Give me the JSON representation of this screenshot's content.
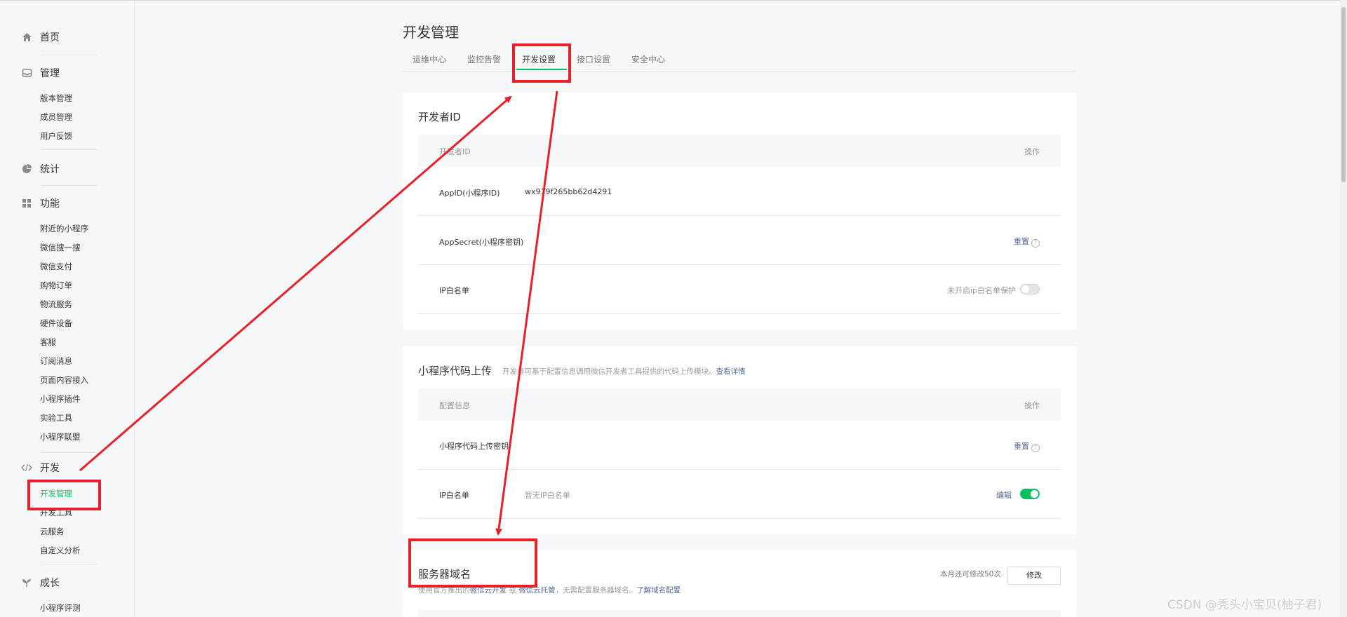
{
  "sidebar": {
    "home": "首页",
    "manage": {
      "title": "管理",
      "items": [
        "版本管理",
        "成员管理",
        "用户反馈"
      ]
    },
    "stats": "统计",
    "features": {
      "title": "功能",
      "items": [
        "附近的小程序",
        "微信搜一搜",
        "微信支付",
        "购物订单",
        "物流服务",
        "硬件设备",
        "客服",
        "订阅消息",
        "页面内容接入",
        "小程序插件",
        "实验工具",
        "小程序联盟"
      ]
    },
    "dev": {
      "title": "开发",
      "items": [
        "开发管理",
        "开发工具",
        "云服务",
        "自定义分析"
      ]
    },
    "growth": {
      "title": "成长",
      "items": [
        "小程序评测"
      ]
    }
  },
  "main": {
    "title": "开发管理",
    "tabs": [
      "运维中心",
      "监控告警",
      "开发设置",
      "接口设置",
      "安全中心"
    ],
    "active_tab": "开发设置"
  },
  "dev_id_card": {
    "title": "开发者ID",
    "col_left": "开发者ID",
    "col_right": "操作",
    "rows": {
      "appid_label": "AppID(小程序ID)",
      "appid_value": "wx919f265bb62d4291",
      "secret_label": "AppSecret(小程序密钥)",
      "secret_action": "重置",
      "ip_label": "IP白名单",
      "ip_status": "未开启ip白名单保护"
    }
  },
  "upload_card": {
    "title": "小程序代码上传",
    "subtitle": "开发者可基于配置信息调用微信开发者工具提供的代码上传模块。",
    "subtitle_link": "查看详情",
    "col_left": "配置信息",
    "col_right": "操作",
    "rows": {
      "key_label": "小程序代码上传密钥",
      "key_action": "重置",
      "ip_label": "IP白名单",
      "ip_value": "暂无IP白名单",
      "ip_action": "编辑"
    }
  },
  "server_card": {
    "title": "服务器域名",
    "desc_1": "使用官方推出的",
    "desc_link1": "微信云开发",
    "desc_2": " 或 ",
    "desc_link2": "微信云托管",
    "desc_3": "，无需配置服务器域名。",
    "desc_link3": "了解域名配置",
    "quota": "本月还可修改50次",
    "modify_button": "修改"
  },
  "help_icon_char": "?",
  "watermark": "CSDN @秃头小宝贝(柚子君)",
  "colors": {
    "accent": "#07c160",
    "link": "#576b95",
    "annotation": "#e8202a"
  }
}
